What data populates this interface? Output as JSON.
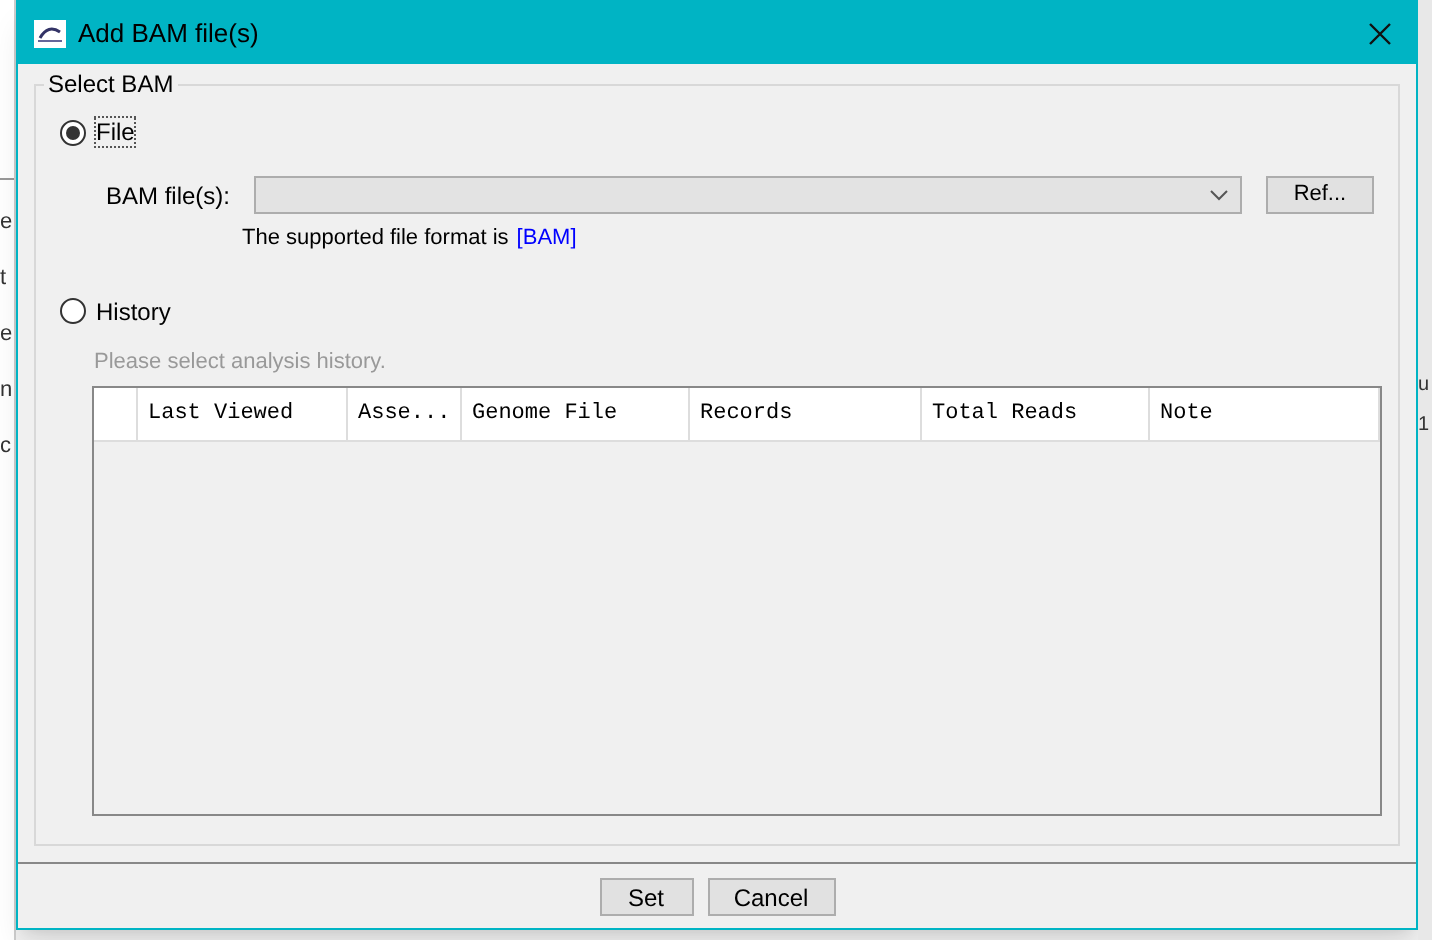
{
  "window": {
    "title": "Add BAM file(s)"
  },
  "background": {
    "left_fragments": [
      "e",
      "t",
      "e",
      "n",
      "c"
    ],
    "right_fragments": [
      "u",
      "1"
    ]
  },
  "group": {
    "title": "Select BAM"
  },
  "options": [
    {
      "label": "File",
      "selected": true
    },
    {
      "label": "History",
      "selected": false
    }
  ],
  "file_section": {
    "label": "BAM file(s):",
    "note": "The supported file format is",
    "format": "[BAM]",
    "browse_button": "Ref..."
  },
  "history_section": {
    "hint": "Please select analysis history.",
    "columns": [
      "",
      "Last Viewed",
      "Asse...",
      "Genome File",
      "Records",
      "Total Reads",
      "Note"
    ]
  },
  "buttons": [
    "Set",
    "Cancel"
  ]
}
